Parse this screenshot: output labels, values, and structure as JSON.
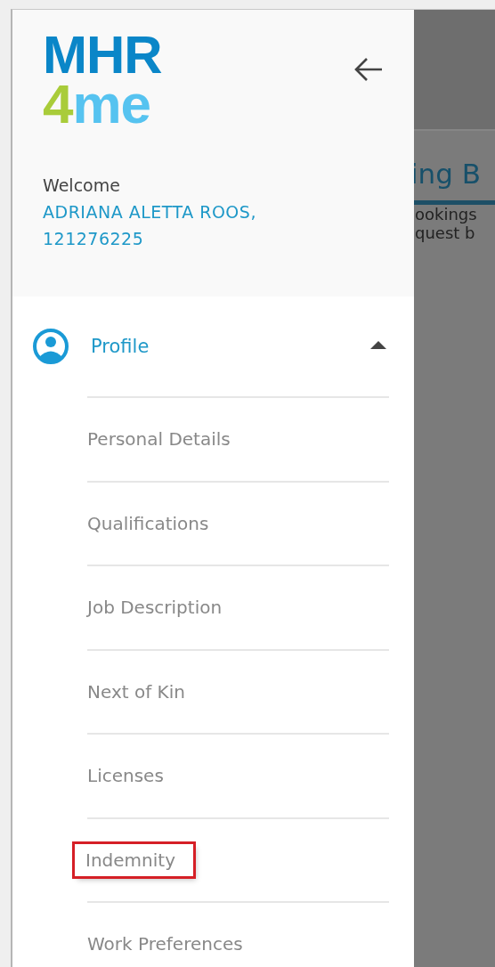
{
  "drawer": {
    "logo": {
      "top": "MHR",
      "digit": "4",
      "word": "me"
    },
    "greeting": "Welcome",
    "user_name": "ADRIANA ALETTA ROOS,",
    "user_id": "121276225",
    "section": {
      "label": "Profile",
      "expanded": true,
      "items": [
        {
          "label": "Personal Details",
          "highlighted": false
        },
        {
          "label": "Qualifications",
          "highlighted": false
        },
        {
          "label": "Job Description",
          "highlighted": false
        },
        {
          "label": "Next of Kin",
          "highlighted": false
        },
        {
          "label": "Licenses",
          "highlighted": false
        },
        {
          "label": "Indemnity",
          "highlighted": true
        },
        {
          "label": "Work Preferences",
          "highlighted": false
        }
      ]
    }
  },
  "background_page": {
    "tab_label": "ing B",
    "lines": [
      "ookings",
      "quest b"
    ]
  }
}
